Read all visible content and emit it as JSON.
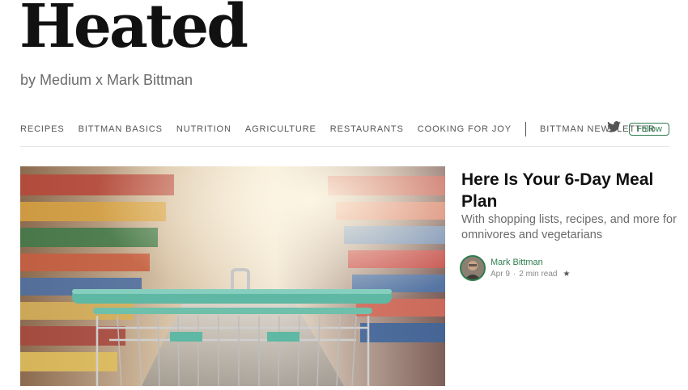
{
  "brand": {
    "title": "Heated",
    "byline": "by Medium x Mark Bittman"
  },
  "nav": {
    "items": [
      "RECIPES",
      "BITTMAN BASICS",
      "NUTRITION",
      "AGRICULTURE",
      "RESTAURANTS",
      "COOKING FOR JOY"
    ],
    "newsletter": "BITTMAN NEWSLETTER",
    "follow_label": "Follow",
    "social_icon": "twitter-icon"
  },
  "article": {
    "title": "Here Is Your 6-Day Meal Plan",
    "subtitle": "With shopping lists, recipes, and more for omnivores and vegetarians",
    "author": "Mark Bittman",
    "date": "Apr 9",
    "separator": "·",
    "read_time": "2 min read",
    "star": "★",
    "image_icon": "grocery-cart-aisle-image"
  },
  "colors": {
    "accent": "#2e7d4f",
    "cart_teal": "#5fb8a3",
    "text_muted": "#6b6b6b"
  }
}
